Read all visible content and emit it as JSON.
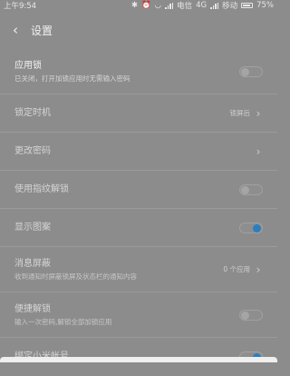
{
  "status_bar": {
    "time": "上午9:54",
    "carrier_1": "电信",
    "network": "4G",
    "carrier_2": "移动",
    "battery_text": "75%"
  },
  "header": {
    "title": "设置"
  },
  "rows": [
    {
      "title": "应用锁",
      "subtitle": "已关闭，打开加锁应用时无需输入密码",
      "control": "toggle",
      "on": false,
      "dim": false
    },
    {
      "title": "锁定时机",
      "value": "锁屏后",
      "control": "chevron",
      "dim": true
    },
    {
      "title": "更改密码",
      "control": "chevron",
      "dim": true
    },
    {
      "title": "使用指纹解锁",
      "control": "toggle",
      "on": false,
      "dim": true
    },
    {
      "title": "显示图案",
      "control": "toggle",
      "on": true,
      "dim": true
    },
    {
      "title": "消息屏蔽",
      "subtitle": "收到通知时屏蔽锁屏及状态栏的通知内容",
      "value": "0 个应用",
      "control": "chevron",
      "dim": true
    },
    {
      "title": "便捷解锁",
      "subtitle": "输入一次密码,解锁全部加锁应用",
      "control": "toggle",
      "on": false,
      "dim": true
    },
    {
      "title": "绑定小米帐号",
      "control": "toggle",
      "on": true,
      "dim": true
    }
  ],
  "colors": {
    "accent": "#2a7fc0"
  }
}
